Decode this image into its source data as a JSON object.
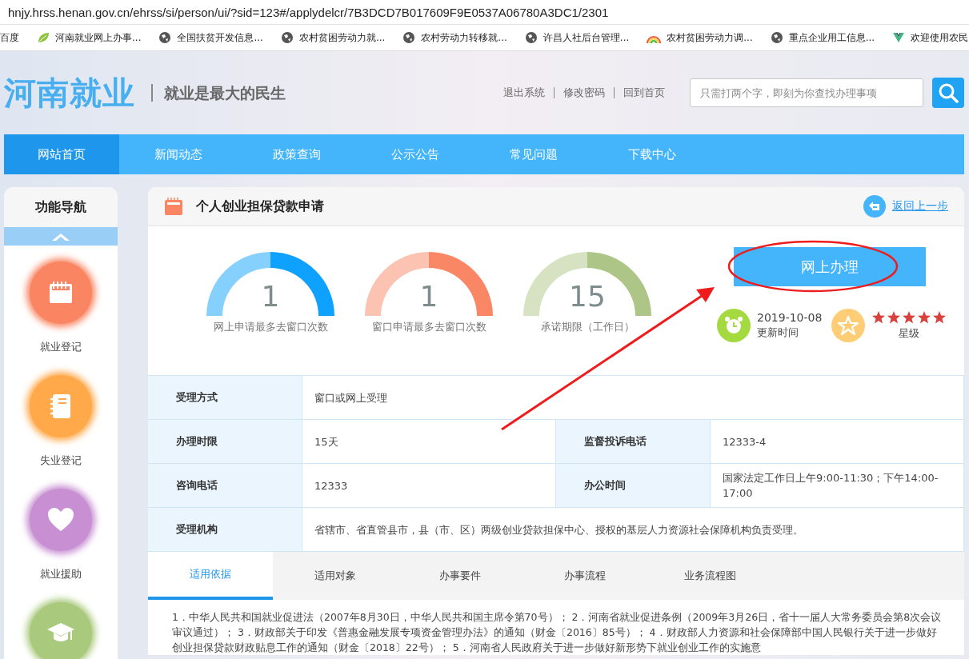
{
  "browser": {
    "url": "hnjy.hrss.henan.gov.cn/ehrss/si/person/ui/?sid=123#/applydelcr/7B3DCD7B017609F9E0537A06780A3DC1/2301",
    "bookmarks": [
      {
        "label": "百度",
        "kind": "none"
      },
      {
        "label": "河南就业网上办事...",
        "kind": "leaf"
      },
      {
        "label": "全国扶贫开发信息...",
        "kind": "globe"
      },
      {
        "label": "农村贫困劳动力就...",
        "kind": "globe"
      },
      {
        "label": "农村劳动力转移就...",
        "kind": "globe"
      },
      {
        "label": "许昌人社后台管理...",
        "kind": "globe"
      },
      {
        "label": "农村贫困劳动力调...",
        "kind": "rainbow"
      },
      {
        "label": "重点企业用工信息...",
        "kind": "globe"
      },
      {
        "label": "欢迎使用农民",
        "kind": "vee"
      }
    ]
  },
  "header": {
    "logo": "河南就业",
    "slogan": "就业是最大的民生",
    "links": [
      "退出系统",
      "修改密码",
      "回到首页"
    ],
    "search": {
      "placeholder": "只需打两个字，即刻为你查找办理事项"
    }
  },
  "nav": [
    {
      "label": "网站首页",
      "selected": true
    },
    {
      "label": "新闻动态",
      "selected": false
    },
    {
      "label": "政策查询",
      "selected": false
    },
    {
      "label": "公示公告",
      "selected": false
    },
    {
      "label": "常见问题",
      "selected": false
    },
    {
      "label": "下载中心",
      "selected": false
    }
  ],
  "sidebar": {
    "title": "功能导航",
    "items": [
      {
        "label": "就业登记",
        "color": "#f98562",
        "kind": "calendar"
      },
      {
        "label": "失业登记",
        "color": "#ffa94a",
        "kind": "notebook"
      },
      {
        "label": "就业援助",
        "color": "#c890d2",
        "kind": "heart"
      },
      {
        "color": "#a9c97c",
        "kind": "cap"
      }
    ]
  },
  "main": {
    "title": "个人创业担保贷款申请",
    "back_link": "返回上一步",
    "gauges": [
      {
        "value": "1",
        "label": "网上申请最多去窗口次数",
        "color": "#0ea1fd"
      },
      {
        "value": "1",
        "label": "窗口申请最多去窗口次数",
        "color": "#f98766"
      },
      {
        "value": "15",
        "label": "承诺期限（工作日）",
        "color": "#adc586"
      }
    ],
    "action_button": "网上办理",
    "updated": {
      "date": "2019-10-08",
      "label": "更新时间"
    },
    "rating": {
      "stars": 5,
      "label": "星级"
    },
    "info_rows": [
      {
        "cells": [
          {
            "label": "受理方式",
            "value": "窗口或网上受理"
          }
        ]
      },
      {
        "cells": [
          {
            "label": "办理时限",
            "value": "15天"
          },
          {
            "label": "监督投诉电话",
            "value": "12333-4"
          }
        ]
      },
      {
        "cells": [
          {
            "label": "咨询电话",
            "value": "12333"
          },
          {
            "label": "办公时间",
            "value": "国家法定工作日上午9:00-11:30；下午14:00-17:00"
          }
        ]
      },
      {
        "cells": [
          {
            "label": "受理机构",
            "value": "省辖市、省直管县市，县（市、区）两级创业贷款担保中心、授权的基层人力资源社会保障机构负责受理。"
          }
        ]
      }
    ],
    "tabs": [
      {
        "label": "适用依据",
        "selected": true
      },
      {
        "label": "适用对象",
        "selected": false
      },
      {
        "label": "办事要件",
        "selected": false
      },
      {
        "label": "办事流程",
        "selected": false
      },
      {
        "label": "业务流程图",
        "selected": false
      }
    ],
    "content": "1．中华人民共和国就业促进法（2007年8月30日，中华人民共和国主席令第70号）；  2．河南省就业促进条例（2009年3月26日，省十一届人大常务委员会第8次会议审议通过）；  3．财政部关于印发《普惠金融发展专项资金管理办法》的通知（财金〔2016〕85号）；  4．财政部人力资源和社会保障部中国人民银行关于进一步做好创业担保贷款财政贴息工作的通知（财金〔2018〕22号）；  5．河南省人民政府关于进一步做好新形势下就业创业工作的实施意"
  },
  "annotations": {
    "ellipse": true,
    "arrow": true
  }
}
